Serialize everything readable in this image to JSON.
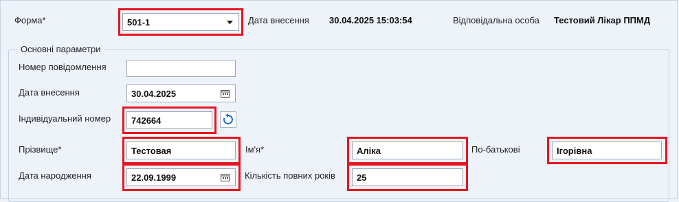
{
  "header": {
    "form_label": "Форма*",
    "form_value": "501-1",
    "entry_date_label": "Дата внесення",
    "entry_date_value": "30.04.2025 15:03:54",
    "responsible_label": "Відповідальна особа",
    "responsible_value": "Тестовий Лікар ППМД"
  },
  "main_params": {
    "legend": "Основні параметри",
    "message_number_label": "Номер повідомлення",
    "message_number_value": "",
    "entry_date_label": "Дата внесення",
    "entry_date_value": "30.04.2025",
    "individual_number_label": "Індивідуальний номер",
    "individual_number_value": "742664",
    "surname_label": "Прізвище*",
    "surname_value": "Тестовая",
    "name_label": "Ім'я*",
    "name_value": "Аліка",
    "patronymic_label": "По-батькові",
    "patronymic_value": "Ігорівна",
    "birth_date_label": "Дата народження",
    "birth_date_value": "22.09.1999",
    "full_years_label": "Кількість повних років",
    "full_years_value": "25"
  },
  "icons": {
    "dropdown": "chevron-down-icon",
    "calendar": "calendar-icon",
    "refresh": "refresh-icon"
  },
  "colors": {
    "highlight": "#e8141e",
    "background": "#eef3fa",
    "refresh_accent": "#1a6fd8"
  }
}
